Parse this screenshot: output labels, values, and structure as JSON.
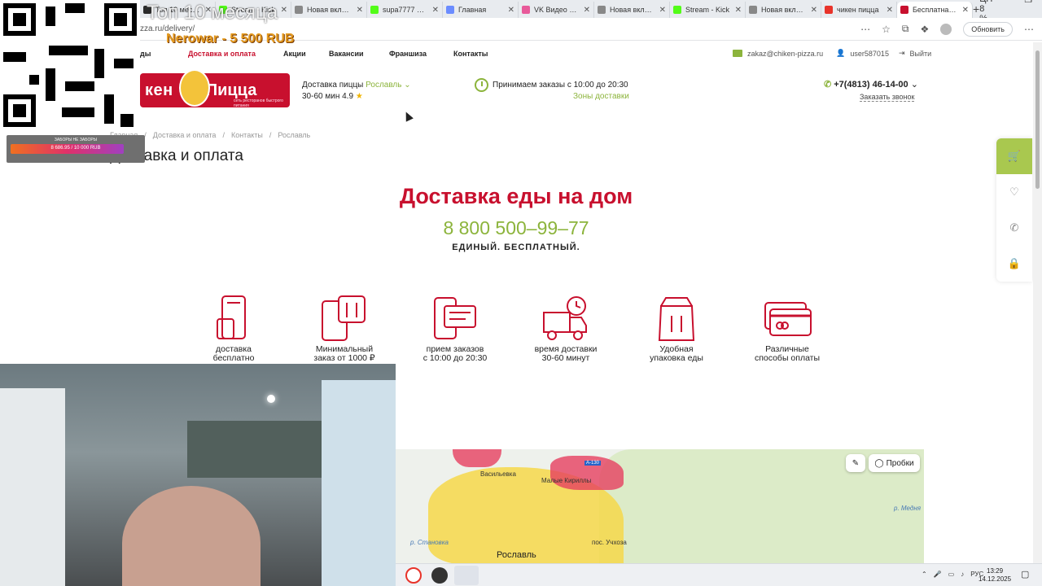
{
  "browser": {
    "tabs": [
      {
        "label": "Топ 10 месяца",
        "fav": "#2b2b2b"
      },
      {
        "label": "Stream - Kick",
        "fav": "#53fc18"
      },
      {
        "label": "Новая вкладка",
        "fav": "#888888"
      },
      {
        "label": "supa7777 Stream",
        "fav": "#53fc18"
      },
      {
        "label": "Главная",
        "fav": "#6b8cff"
      },
      {
        "label": "VK Видео — с",
        "fav": "#e85a9a"
      },
      {
        "label": "Новая вкладка",
        "fav": "#888888"
      },
      {
        "label": "Stream - Kick",
        "fav": "#53fc18"
      },
      {
        "label": "Новая вкладка",
        "fav": "#888888"
      },
      {
        "label": "чикен пицца",
        "fav": "#e8332a"
      },
      {
        "label": "Бесплатная д",
        "fav": "#c8102e",
        "active": true
      }
    ],
    "url": "zza.ru/delivery/",
    "update_label": "Обновить",
    "status_text": "ЦП 8 %"
  },
  "nav": {
    "items": [
      "ды",
      "Доставка и оплата",
      "Акции",
      "Вакансии",
      "Франшиза",
      "Контакты"
    ],
    "email": "zakaz@chiken-pizza.ru",
    "user": "user587015",
    "logout": "Выйти"
  },
  "logo": {
    "part1": "кен",
    "part2": "Пицца",
    "subtitle": "сеть ресторанов быстрого питания"
  },
  "header": {
    "delivery_label": "Доставка пиццы",
    "city": "Рославль",
    "delivery_time": "30-60 мин 4.9",
    "hours": "Принимаем заказы с 10:00 до 20:30",
    "zones": "Зоны доставки",
    "phone": "+7(4813) 46-14-00",
    "callback": "Заказать звонок"
  },
  "breadcrumb": [
    "Главная",
    "/",
    "Доставка и оплата",
    "/",
    "Контакты",
    "/",
    "Рославль"
  ],
  "page_title": "Доставка и оплата",
  "hero": {
    "title": "Доставка еды на дом",
    "phone": "8 800 500–99–77",
    "subtitle": "ЕДИНЫЙ. БЕСПЛАТНЫЙ."
  },
  "features": [
    {
      "line1": "доставка",
      "line2": "бесплатно",
      "icon": "phone-delivery-icon"
    },
    {
      "line1": "Минимальный",
      "line2": "заказ от 1000 ₽",
      "icon": "app-order-icon"
    },
    {
      "line1": "прием заказов",
      "line2": "с 10:00 до 20:30",
      "icon": "chat-phone-icon"
    },
    {
      "line1": "время доставки",
      "line2": "30-60 минут",
      "icon": "truck-clock-icon"
    },
    {
      "line1": "Удобная",
      "line2": "упаковка еды",
      "icon": "food-bag-icon"
    },
    {
      "line1": "Различные",
      "line2": "способы оплаты",
      "icon": "credit-card-icon"
    }
  ],
  "map": {
    "traffic_label": "Пробки",
    "labels": [
      "Васильевка",
      "Малые Кириллы",
      "А-130",
      "пос. Учхоза",
      "р. Медня",
      "р. Становка"
    ],
    "city": "Рославль"
  },
  "overlay": {
    "top_text": "Топ 10 месяца",
    "donation": "Nerowar - 5 500 RUB",
    "goal_title": "ЗАБОРЫ НЕ ЗАБОРЫ",
    "goal_text": "8 686.95 / 10 000 RUB",
    "goal_progress": 0.87
  },
  "taskbar": {
    "lang": "РУС",
    "time": "13:29",
    "date": "14.12.2025"
  },
  "colors": {
    "brand_red": "#c8102e",
    "brand_green": "#8cb43c"
  }
}
